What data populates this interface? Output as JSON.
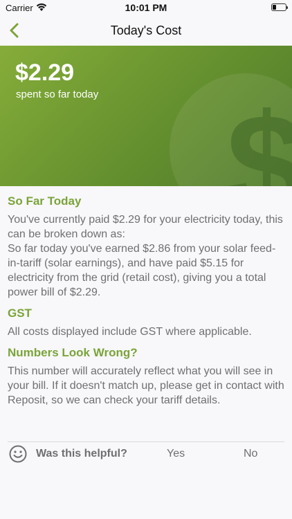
{
  "status_bar": {
    "carrier": "Carrier",
    "time": "10:01 PM"
  },
  "nav": {
    "title": "Today's Cost",
    "back_icon": "chevron-left-icon"
  },
  "hero": {
    "amount": "$2.29",
    "subtitle": "spent so far today",
    "background_icon": "dollar-circle-icon"
  },
  "sections": [
    {
      "heading": "So Far Today",
      "paragraphs": [
        "You've currently paid $2.29 for your electricity today, this can be broken down as:",
        "So far today you've earned $2.86 from your solar feed-in-tariff (solar earnings), and have paid $5.15 for electricity from the grid (retail cost), giving you a total power bill of $2.29."
      ]
    },
    {
      "heading": "GST",
      "paragraphs": [
        "All costs displayed include GST where applicable."
      ]
    },
    {
      "heading": "Numbers Look Wrong?",
      "paragraphs": [
        "This number will accurately reflect what you will see in your bill. If it doesn't match up, please get in contact with Reposit, so we can check your tariff details."
      ]
    }
  ],
  "feedback": {
    "question": "Was this helpful?",
    "yes": "Yes",
    "no": "No"
  },
  "colors": {
    "accent": "#7aa43a",
    "hero_start": "#86ad3a",
    "hero_end": "#4f7a2a"
  }
}
